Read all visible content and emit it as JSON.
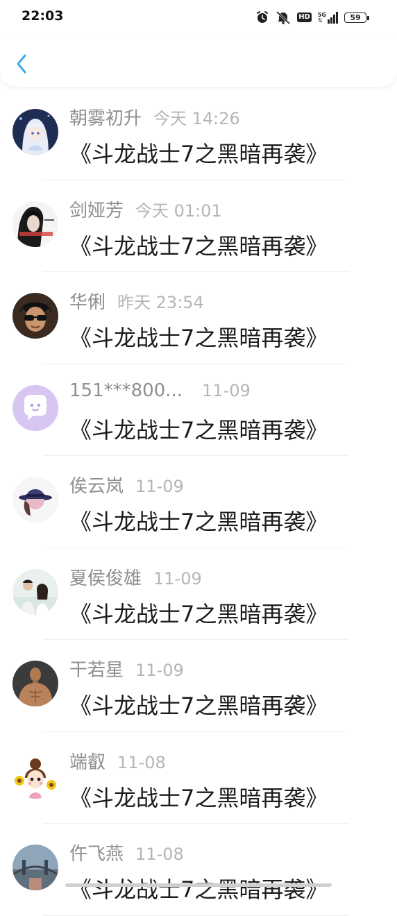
{
  "status_bar": {
    "time": "22:03",
    "network": "5G",
    "hd": "HD",
    "battery": "59"
  },
  "header": {
    "back_icon": "chevron-left-icon",
    "accent_color": "#3ea9e6"
  },
  "messages": [
    {
      "name": "朝雾初升",
      "time": "今天 14:26",
      "text": "《斗龙战士7之黑暗再袭》",
      "avatar": "anime-girl-avatar"
    },
    {
      "name": "剑娅芳",
      "time": "今天 01:01",
      "text": "《斗龙战士7之黑暗再袭》",
      "avatar": "woman-portrait-avatar"
    },
    {
      "name": "华俐",
      "time": "昨天 23:54",
      "text": "《斗龙战士7之黑暗再袭》",
      "avatar": "sunglasses-man-avatar"
    },
    {
      "name": "151***800...",
      "time": "11-09",
      "text": "《斗龙战士7之黑暗再袭》",
      "avatar": "default-chat-avatar"
    },
    {
      "name": "俟云岚",
      "time": "11-09",
      "text": "《斗龙战士7之黑暗再袭》",
      "avatar": "hat-avatar"
    },
    {
      "name": "夏侯俊雄",
      "time": "11-09",
      "text": "《斗龙战士7之黑暗再袭》",
      "avatar": "couple-avatar"
    },
    {
      "name": "干若星",
      "time": "11-09",
      "text": "《斗龙战士7之黑暗再袭》",
      "avatar": "muscle-man-avatar"
    },
    {
      "name": "端叡",
      "time": "11-08",
      "text": "《斗龙战士7之黑暗再袭》",
      "avatar": "cartoon-girl-sunflower-avatar"
    },
    {
      "name": "仵飞燕",
      "time": "11-08",
      "text": "《斗龙战士7之黑暗再袭》",
      "avatar": "city-bridge-avatar"
    }
  ]
}
